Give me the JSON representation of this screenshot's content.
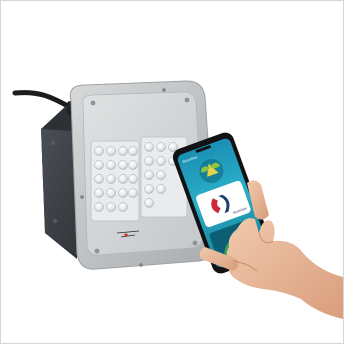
{
  "product_photo": {
    "subject": "LED floodlight with smartphone app control",
    "background_color": "#ffffff",
    "border_color": "#d6d6d6",
    "phone_app": {
      "header_text": "Illumitex",
      "brand_text": "Illumitex",
      "accent_colors": [
        "#1b8fb4",
        "#2bb0c9",
        "#d0253a",
        "#1e3a6e"
      ]
    }
  }
}
